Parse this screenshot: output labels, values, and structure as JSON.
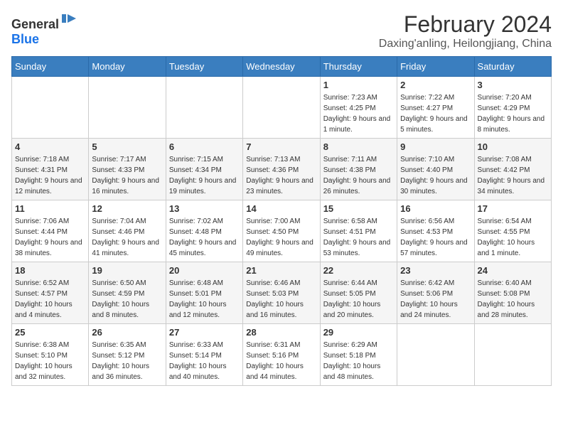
{
  "logo": {
    "general": "General",
    "blue": "Blue"
  },
  "title": {
    "month": "February 2024",
    "location": "Daxing'anling, Heilongjiang, China"
  },
  "days_of_week": [
    "Sunday",
    "Monday",
    "Tuesday",
    "Wednesday",
    "Thursday",
    "Friday",
    "Saturday"
  ],
  "weeks": [
    {
      "days": [
        {
          "empty": true
        },
        {
          "empty": true
        },
        {
          "empty": true
        },
        {
          "empty": true
        },
        {
          "num": "1",
          "sunrise": "7:23 AM",
          "sunset": "4:25 PM",
          "daylight": "9 hours and 1 minute."
        },
        {
          "num": "2",
          "sunrise": "7:22 AM",
          "sunset": "4:27 PM",
          "daylight": "9 hours and 5 minutes."
        },
        {
          "num": "3",
          "sunrise": "7:20 AM",
          "sunset": "4:29 PM",
          "daylight": "9 hours and 8 minutes."
        }
      ]
    },
    {
      "days": [
        {
          "num": "4",
          "sunrise": "7:18 AM",
          "sunset": "4:31 PM",
          "daylight": "9 hours and 12 minutes."
        },
        {
          "num": "5",
          "sunrise": "7:17 AM",
          "sunset": "4:33 PM",
          "daylight": "9 hours and 16 minutes."
        },
        {
          "num": "6",
          "sunrise": "7:15 AM",
          "sunset": "4:34 PM",
          "daylight": "9 hours and 19 minutes."
        },
        {
          "num": "7",
          "sunrise": "7:13 AM",
          "sunset": "4:36 PM",
          "daylight": "9 hours and 23 minutes."
        },
        {
          "num": "8",
          "sunrise": "7:11 AM",
          "sunset": "4:38 PM",
          "daylight": "9 hours and 26 minutes."
        },
        {
          "num": "9",
          "sunrise": "7:10 AM",
          "sunset": "4:40 PM",
          "daylight": "9 hours and 30 minutes."
        },
        {
          "num": "10",
          "sunrise": "7:08 AM",
          "sunset": "4:42 PM",
          "daylight": "9 hours and 34 minutes."
        }
      ]
    },
    {
      "days": [
        {
          "num": "11",
          "sunrise": "7:06 AM",
          "sunset": "4:44 PM",
          "daylight": "9 hours and 38 minutes."
        },
        {
          "num": "12",
          "sunrise": "7:04 AM",
          "sunset": "4:46 PM",
          "daylight": "9 hours and 41 minutes."
        },
        {
          "num": "13",
          "sunrise": "7:02 AM",
          "sunset": "4:48 PM",
          "daylight": "9 hours and 45 minutes."
        },
        {
          "num": "14",
          "sunrise": "7:00 AM",
          "sunset": "4:50 PM",
          "daylight": "9 hours and 49 minutes."
        },
        {
          "num": "15",
          "sunrise": "6:58 AM",
          "sunset": "4:51 PM",
          "daylight": "9 hours and 53 minutes."
        },
        {
          "num": "16",
          "sunrise": "6:56 AM",
          "sunset": "4:53 PM",
          "daylight": "9 hours and 57 minutes."
        },
        {
          "num": "17",
          "sunrise": "6:54 AM",
          "sunset": "4:55 PM",
          "daylight": "10 hours and 1 minute."
        }
      ]
    },
    {
      "days": [
        {
          "num": "18",
          "sunrise": "6:52 AM",
          "sunset": "4:57 PM",
          "daylight": "10 hours and 4 minutes."
        },
        {
          "num": "19",
          "sunrise": "6:50 AM",
          "sunset": "4:59 PM",
          "daylight": "10 hours and 8 minutes."
        },
        {
          "num": "20",
          "sunrise": "6:48 AM",
          "sunset": "5:01 PM",
          "daylight": "10 hours and 12 minutes."
        },
        {
          "num": "21",
          "sunrise": "6:46 AM",
          "sunset": "5:03 PM",
          "daylight": "10 hours and 16 minutes."
        },
        {
          "num": "22",
          "sunrise": "6:44 AM",
          "sunset": "5:05 PM",
          "daylight": "10 hours and 20 minutes."
        },
        {
          "num": "23",
          "sunrise": "6:42 AM",
          "sunset": "5:06 PM",
          "daylight": "10 hours and 24 minutes."
        },
        {
          "num": "24",
          "sunrise": "6:40 AM",
          "sunset": "5:08 PM",
          "daylight": "10 hours and 28 minutes."
        }
      ]
    },
    {
      "days": [
        {
          "num": "25",
          "sunrise": "6:38 AM",
          "sunset": "5:10 PM",
          "daylight": "10 hours and 32 minutes."
        },
        {
          "num": "26",
          "sunrise": "6:35 AM",
          "sunset": "5:12 PM",
          "daylight": "10 hours and 36 minutes."
        },
        {
          "num": "27",
          "sunrise": "6:33 AM",
          "sunset": "5:14 PM",
          "daylight": "10 hours and 40 minutes."
        },
        {
          "num": "28",
          "sunrise": "6:31 AM",
          "sunset": "5:16 PM",
          "daylight": "10 hours and 44 minutes."
        },
        {
          "num": "29",
          "sunrise": "6:29 AM",
          "sunset": "5:18 PM",
          "daylight": "10 hours and 48 minutes."
        },
        {
          "empty": true
        },
        {
          "empty": true
        }
      ]
    }
  ]
}
